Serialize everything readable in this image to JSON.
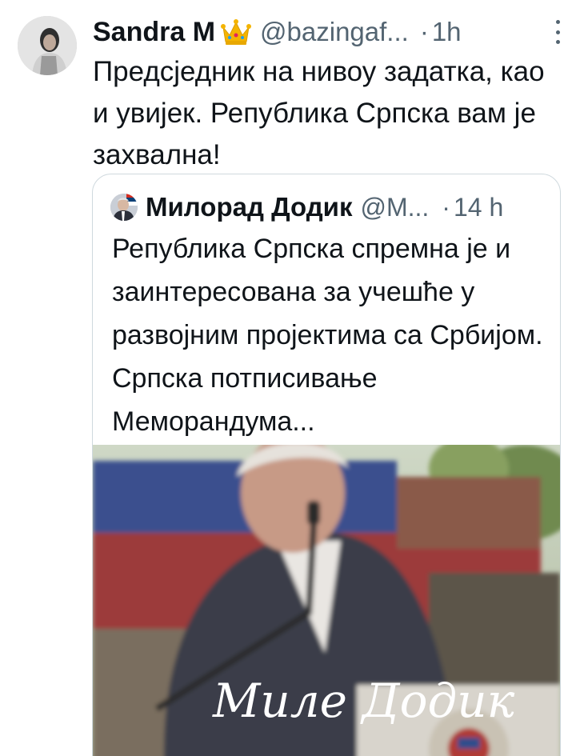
{
  "tweet": {
    "author_name": "Sandra M",
    "author_badge_icon": "crown-emoji",
    "handle": "@bazingaf...",
    "separator": "·",
    "time": "1h",
    "text": "Предсједник на нивоу задатка, као и увијек. Република Српска вам је захвална!"
  },
  "quote": {
    "author_name": "Милорад Додик",
    "handle": "@M...",
    "separator": "·",
    "time": "14 h",
    "text": "Република Српска спремна је и заинтересована за учешће у развојним пројектима са Србијом. Српска потписивање Меморандума...",
    "media_signature": "Миле Додик"
  },
  "colors": {
    "text_primary": "#0f1419",
    "text_secondary": "#536471",
    "border": "#cfd9de"
  }
}
